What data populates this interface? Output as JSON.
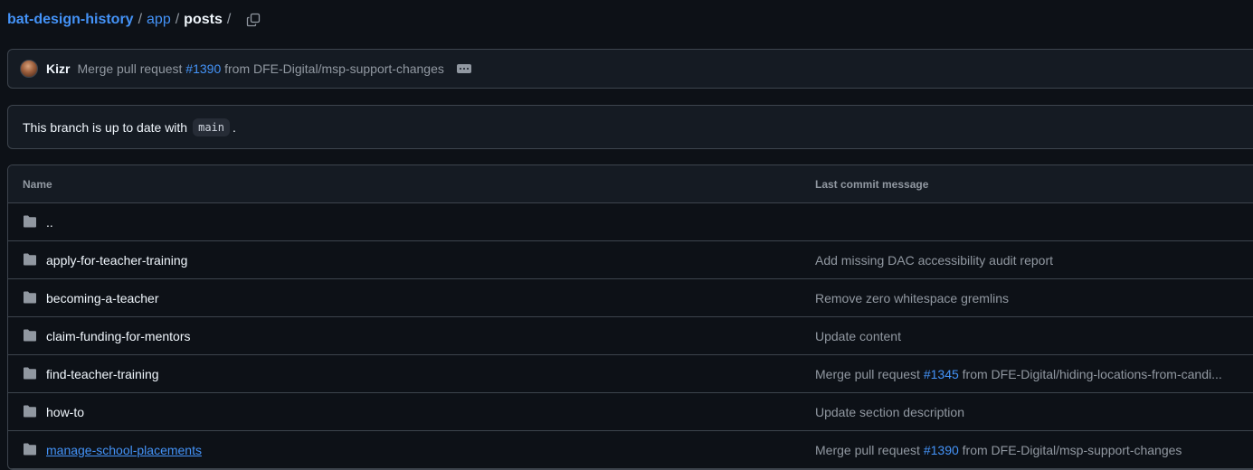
{
  "breadcrumb": {
    "repo": "bat-design-history",
    "sep1": "/",
    "dir": "app",
    "sep2": "/",
    "current": "posts",
    "sep3": "/"
  },
  "commit": {
    "author": "Kizr",
    "message_prefix": "Merge pull request ",
    "pr_link": "#1390",
    "message_suffix": " from DFE-Digital/msp-support-changes"
  },
  "branch_status": {
    "text_before": "This branch is up to date with",
    "branch": "main",
    "text_after": "."
  },
  "table": {
    "columns": [
      "Name",
      "Last commit message"
    ],
    "rows": [
      {
        "name": "..",
        "msg_text": "",
        "msg_link": "",
        "msg_suffix": ""
      },
      {
        "name": "apply-for-teacher-training",
        "msg_text": "Add missing DAC accessibility audit report",
        "msg_link": "",
        "msg_suffix": ""
      },
      {
        "name": "becoming-a-teacher",
        "msg_text": "Remove zero whitespace gremlins",
        "msg_link": "",
        "msg_suffix": ""
      },
      {
        "name": "claim-funding-for-mentors",
        "msg_text": "Update content",
        "msg_link": "",
        "msg_suffix": ""
      },
      {
        "name": "find-teacher-training",
        "msg_text": "Merge pull request ",
        "msg_link": "#1345",
        "msg_suffix": " from DFE-Digital/hiding-locations-from-candi..."
      },
      {
        "name": "how-to",
        "msg_text": "Update section description",
        "msg_link": "",
        "msg_suffix": ""
      },
      {
        "name": "manage-school-placements",
        "msg_text": "Merge pull request ",
        "msg_link": "#1390",
        "msg_suffix": " from DFE-Digital/msp-support-changes"
      }
    ]
  },
  "icons": {
    "copy": "copy-icon",
    "folder": "folder-icon",
    "ellipsis": "ellipsis-icon",
    "avatar": "avatar"
  },
  "colors": {
    "link": "#4493f8",
    "background": "#0d1117",
    "border": "#3d444d"
  }
}
